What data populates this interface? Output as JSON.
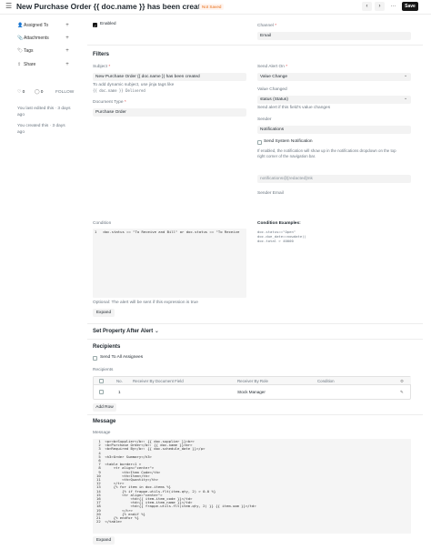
{
  "header": {
    "title": "New Purchase Order {{ doc.name }} has been created",
    "status_badge": "Not Saved",
    "prev_icon": "chevron-left-icon",
    "next_icon": "chevron-right-icon",
    "more_icon": "more-dots-icon",
    "save_label": "Save"
  },
  "sidebar": {
    "items": [
      {
        "label": "Assigned To",
        "icon": "user-icon"
      },
      {
        "label": "Attachments",
        "icon": "paperclip-icon"
      },
      {
        "label": "Tags",
        "icon": "tag-icon"
      },
      {
        "label": "Share",
        "icon": "share-icon"
      }
    ],
    "likes": "0",
    "comments": "0",
    "follow_label": "FOLLOW",
    "activity": [
      {
        "line1": "You last edited this · 3 days",
        "line2": "ago"
      },
      {
        "line1": "You created this · 3 days",
        "line2": "ago"
      }
    ]
  },
  "top_fields": {
    "enabled_label": "Enabled",
    "channel_label": "Channel",
    "channel_value": "Email"
  },
  "filters": {
    "section_title": "Filters",
    "subject_label": "Subject",
    "subject_value": "New Purchase Order {{ doc.name }} has been created",
    "subject_help_1": "To add dynamic subject, use jinja tags like",
    "subject_help_2": "{{ doc.name }} Delivered",
    "doctype_label": "Document Type",
    "doctype_value": "Purchase Order",
    "send_alert_on_label": "Send Alert On",
    "send_alert_on_value": "Value Change",
    "value_changed_label": "Value Changed",
    "value_changed_value": "status (Status)",
    "value_changed_help": "Send alert if this field's value changes",
    "sender_label": "Sender",
    "sender_value": "Notifications",
    "send_system_notification_label": "Send System Notification",
    "system_notification_help_1": "If enabled, the notification will show up in the notifications dropdown on the top",
    "system_notification_help_2": "right corner of the navigation bar.",
    "sender_email_label": "Sender Email",
    "sender_email_value": "notifications@[redacted]mk",
    "condition_label": "Condition",
    "condition_code": "1   doc.status == \"To Receive and Bill\" or doc.status == \"To Receive",
    "condition_help": "Optional: The alert will be sent if this expression is true",
    "condition_expand": "Expand",
    "condition_examples_title": "Condition Examples:",
    "condition_examples": [
      "doc.status==\"Open\"",
      "doc.due_date==nowdate()",
      "doc.total > 40000"
    ]
  },
  "set_property": {
    "section_title": "Set Property After Alert",
    "chevron_icon": "chevron-down-icon"
  },
  "recipients": {
    "section_title": "Recipients",
    "send_to_all_label": "Send To All Assignees",
    "table_label": "Recipients",
    "columns": [
      "No.",
      "Receiver By Document Field",
      "Receiver By Role",
      "Condition"
    ],
    "settings_icon": "gear-icon",
    "rows": [
      {
        "no": "1",
        "field": "",
        "role": "Stock Manager",
        "condition": "",
        "edit_icon": "edit-icon"
      }
    ],
    "add_row_label": "Add Row"
  },
  "message": {
    "section_title": "Message",
    "field_label": "Message",
    "code_lines": [
      " 1  <p><b>Supplier</b>: {{ doc.supplier }}<br>",
      " 2  <b>Purchase Order</b>: {{ doc.name }}<br>",
      " 3  <b>Required By</b>: {{ doc.schedule_date }}</p>",
      " 4  ",
      " 5  <h3>Order Summary</h3>",
      " 6  ",
      " 7  <table border=1 >",
      " 8      <tr align=\"center\">",
      " 9          <th>Item Code</th>",
      "10          <th>Item</th>",
      "11          <th>Quantity</th>",
      "12      </tr>",
      "13      {% for item in doc.items %}",
      "14          {% if frappe.utils.flt(item.qty, 2) > 0.0 %}",
      "15          <tr align=\"center\">",
      "16              <td>{{ item.item_code }}</td>",
      "17              <td>{{ item.item_name }}</td>",
      "18              <td>{{ frappe.utils.flt(item.qty, 2) }} {{ item.uom }}</td>",
      "19          </tr>",
      "20          {% endif %}",
      "21      {% endfor %}",
      "22  </table>"
    ],
    "expand_label": "Expand"
  }
}
